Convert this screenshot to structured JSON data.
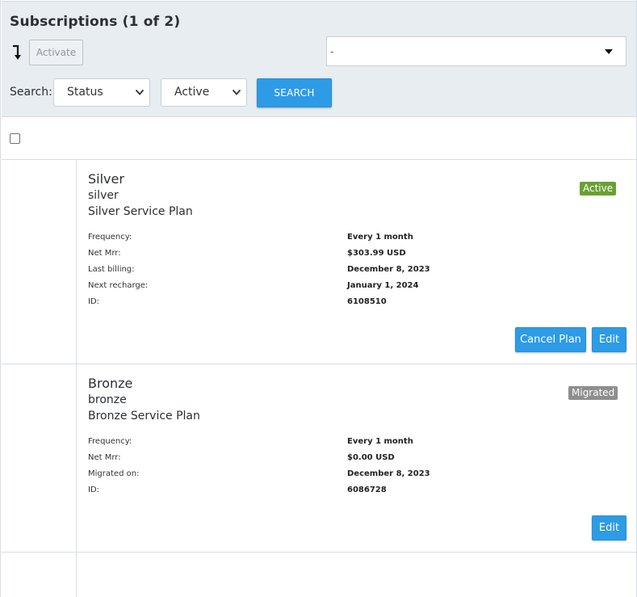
{
  "header": {
    "title": "Subscriptions (1 of 2)",
    "activate_label": "Activate",
    "bulk_select_value": "-",
    "search_label": "Search:",
    "filter_field": "Status",
    "filter_value": "Active",
    "search_button": "SEARCH"
  },
  "subscriptions": [
    {
      "name": "Silver",
      "handle": "silver",
      "description": "Silver Service Plan",
      "status": "Active",
      "status_color": "#6aa033",
      "details": [
        {
          "label": "Frequency:",
          "value": "Every 1 month"
        },
        {
          "label": "Net Mrr:",
          "value": "$303.99 USD"
        },
        {
          "label": "Last billing:",
          "value": "December 8, 2023"
        },
        {
          "label": "Next recharge:",
          "value": "January 1, 2024"
        },
        {
          "label": "ID:",
          "value": "6108510"
        }
      ],
      "actions": [
        "Cancel Plan",
        "Edit"
      ]
    },
    {
      "name": "Bronze",
      "handle": "bronze",
      "description": "Bronze Service Plan",
      "status": "Migrated",
      "status_color": "#8e8e8e",
      "details": [
        {
          "label": "Frequency:",
          "value": "Every 1 month"
        },
        {
          "label": "Net Mrr:",
          "value": "$0.00 USD"
        },
        {
          "label": "Migrated on:",
          "value": "December 8, 2023"
        },
        {
          "label": "ID:",
          "value": "6086728"
        }
      ],
      "actions": [
        "Edit"
      ]
    }
  ],
  "colors": {
    "accent": "#2d9be6",
    "header_bg": "#e8edf1"
  },
  "icons": {
    "sort": "sort-arrow-down-icon",
    "dropdown": "caret-down-icon",
    "chevron": "chevron-down-icon"
  }
}
